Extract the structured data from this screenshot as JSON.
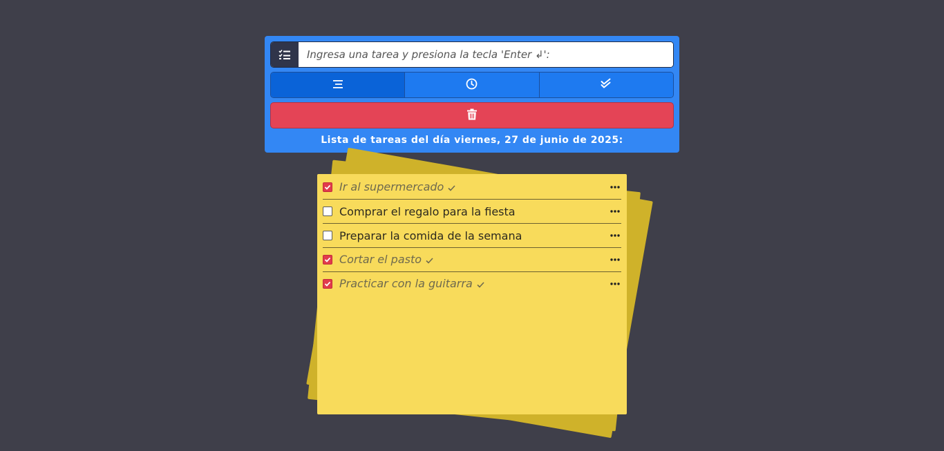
{
  "input": {
    "placeholder": "Ingresa una tarea y presiona la tecla 'Enter ↲':",
    "icon": "task-list-icon"
  },
  "filters": [
    {
      "icon": "list-icon",
      "active": true
    },
    {
      "icon": "clock-icon",
      "active": false
    },
    {
      "icon": "double-check-icon",
      "active": false
    }
  ],
  "delete": {
    "icon": "trash-icon"
  },
  "list_title": "Lista de tareas del día viernes, 27 de junio de 2025:",
  "tasks": [
    {
      "text": "Ir al supermercado",
      "done": true
    },
    {
      "text": "Comprar el regalo para la fiesta",
      "done": false
    },
    {
      "text": "Preparar la comida de la semana",
      "done": false
    },
    {
      "text": "Cortar el pasto",
      "done": true
    },
    {
      "text": "Practicar con la guitarra",
      "done": true
    }
  ],
  "colors": {
    "background": "#3f3f4a",
    "panel": "#3387f4",
    "delete": "#e44456",
    "note": "#f8db5b",
    "checked": "#e13b4c"
  }
}
